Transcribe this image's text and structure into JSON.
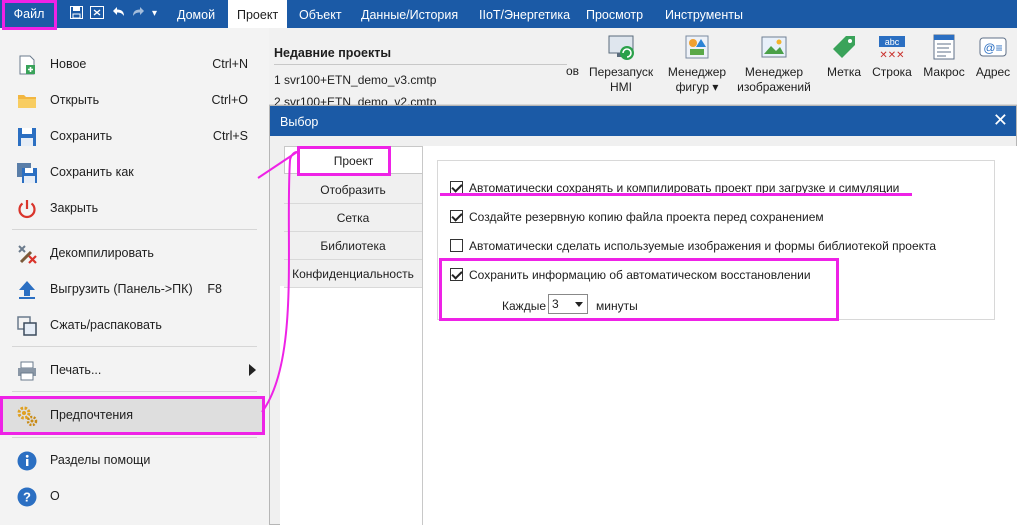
{
  "menubar": {
    "file": "Файл",
    "tabs": [
      {
        "label": "Домой"
      },
      {
        "label": "Проект"
      },
      {
        "label": "Объект"
      },
      {
        "label": "Данные/История"
      },
      {
        "label": "IIoT/Энергетика"
      },
      {
        "label": "Просмотр"
      },
      {
        "label": "Инструменты"
      }
    ],
    "active_tab": "Проект"
  },
  "ribbon": {
    "items": [
      {
        "label": "ов"
      },
      {
        "label": "Перезапуск\nHMI"
      },
      {
        "label": "Менеджер\nфигур ▾"
      },
      {
        "label": "Менеджер\nизображений"
      },
      {
        "label": "Метка"
      },
      {
        "label": "Строка"
      },
      {
        "label": "Макрос"
      },
      {
        "label": "Адрес"
      }
    ],
    "icon_text": "abc"
  },
  "backstage": {
    "items": [
      {
        "label": "Новое",
        "shortcut": "Ctrl+N",
        "icon": "new-file-icon"
      },
      {
        "label": "Открыть",
        "shortcut": "Ctrl+O",
        "icon": "open-folder-icon"
      },
      {
        "label": "Сохранить",
        "shortcut": "Ctrl+S",
        "icon": "save-icon"
      },
      {
        "label": "Сохранить как",
        "shortcut": "",
        "icon": "save-as-icon"
      },
      {
        "label": "Закрыть",
        "shortcut": "",
        "icon": "power-icon"
      },
      {
        "label": "Декомпилировать",
        "shortcut": "",
        "icon": "decompile-icon"
      },
      {
        "label": "Выгрузить (Панель->ПК)",
        "shortcut": "F8",
        "icon": "upload-icon"
      },
      {
        "label": "Сжать/распаковать",
        "shortcut": "",
        "icon": "compress-icon"
      },
      {
        "label": "Печать...",
        "shortcut": "",
        "icon": "printer-icon"
      },
      {
        "label": "Предпочтения",
        "shortcut": "",
        "icon": "gears-icon"
      },
      {
        "label": "Разделы помощи",
        "shortcut": "",
        "icon": "info-icon"
      },
      {
        "label": "О",
        "shortcut": "",
        "icon": "help-icon"
      }
    ]
  },
  "recent": {
    "title": "Недавние проекты",
    "items": [
      "1 svr100+ETN_demo_v3.cmtp",
      "2 svr100+ETN_demo_v2.cmtp"
    ]
  },
  "dialog": {
    "title": "Выбор",
    "tabs": [
      "Проект",
      "Отобразить",
      "Сетка",
      "Библиотека",
      "Конфиденциальность"
    ],
    "options": [
      {
        "label": "Автоматически сохранять и компилировать проект при загрузке и симуляции",
        "checked": true
      },
      {
        "label": "Создайте резервную копию файла проекта перед сохранением",
        "checked": true
      },
      {
        "label": "Автоматически сделать используемые изображения и формы библиотекой проекта",
        "checked": false
      },
      {
        "label": "Сохранить информацию об автоматическом восстановлении",
        "checked": true
      }
    ],
    "every_label": "Каждые",
    "minutes_value": "3",
    "minutes_label": "минуты"
  },
  "colors": {
    "accent": "#1b5aa6",
    "annotation": "#ee22e6"
  }
}
